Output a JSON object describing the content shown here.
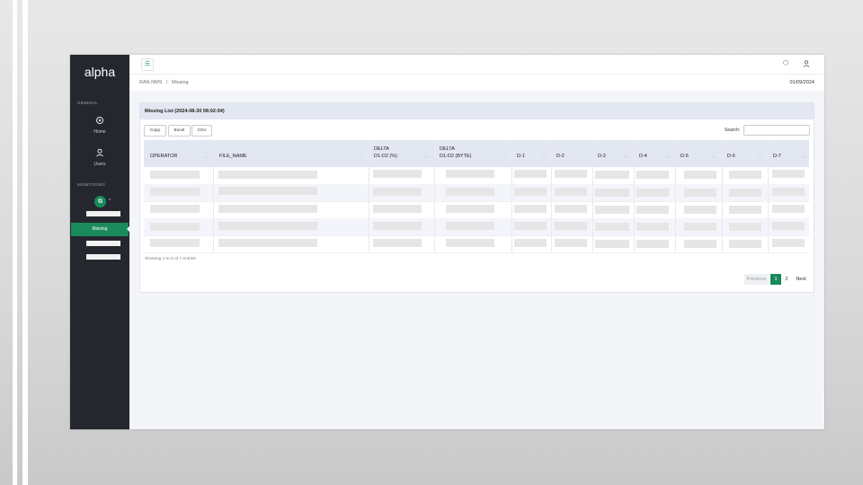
{
  "app": {
    "logo": "alpha"
  },
  "sidebar": {
    "general_label": "GENERAL",
    "monitoring_label": "MONITORING",
    "items": [
      {
        "label": "Home",
        "icon": "home-icon"
      },
      {
        "label": "Users",
        "icon": "user-icon"
      }
    ],
    "active_item": "Missing"
  },
  "breadcrumb": {
    "parent": "RAN NMS",
    "separator": "/",
    "current": "Missing"
  },
  "header": {
    "date": "01/09/2024"
  },
  "card": {
    "title": "Missing List (2024-08-30 08:02:04)",
    "buttons": {
      "copy": "Copy",
      "excel": "Excel",
      "csv": "CSV"
    },
    "search_label": "Search:",
    "search_placeholder": ""
  },
  "table": {
    "columns": [
      {
        "line1": "",
        "line2": "OPERATOR"
      },
      {
        "line1": "",
        "line2": "FILE_NAME"
      },
      {
        "line1": "DELTA",
        "line2": "D1-D2 (%)"
      },
      {
        "line1": "DELTA",
        "line2": "D1-D2 (BYTE)"
      },
      {
        "line1": "",
        "line2": "D-1"
      },
      {
        "line1": "",
        "line2": "D-2"
      },
      {
        "line1": "",
        "line2": "D-3"
      },
      {
        "line1": "",
        "line2": "D-4"
      },
      {
        "line1": "",
        "line2": "D-5"
      },
      {
        "line1": "",
        "line2": "D-6"
      },
      {
        "line1": "",
        "line2": "D-7"
      }
    ],
    "info": "Showing 1 to 5 of 7 entries"
  },
  "pagination": {
    "previous": "Previous",
    "pages": [
      "1",
      "2"
    ],
    "current": "1",
    "next": "Next"
  },
  "colors": {
    "accent": "#1b8a5a",
    "sidebar_bg": "#24282e",
    "table_head_bg": "#e2e7f1"
  }
}
